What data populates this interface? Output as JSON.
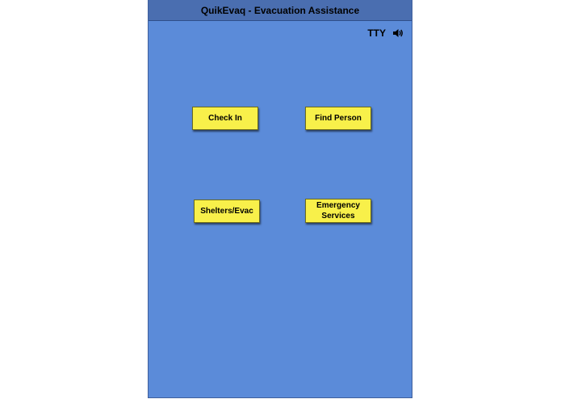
{
  "window": {
    "title": "QuikEvaq - Evacuation Assistance"
  },
  "accessibility": {
    "tty_label": "TTY",
    "speaker_icon": "speaker-volume-icon"
  },
  "menu": {
    "check_in_label": "Check In",
    "find_person_label": "Find Person",
    "shelters_label": "Shelters/Evac",
    "emergency_label_line1": "Emergency",
    "emergency_label_line2": "Services"
  },
  "colors": {
    "background": "#5b8bd9",
    "titlebar": "#4a6eb0",
    "button": "#f8f04a"
  }
}
